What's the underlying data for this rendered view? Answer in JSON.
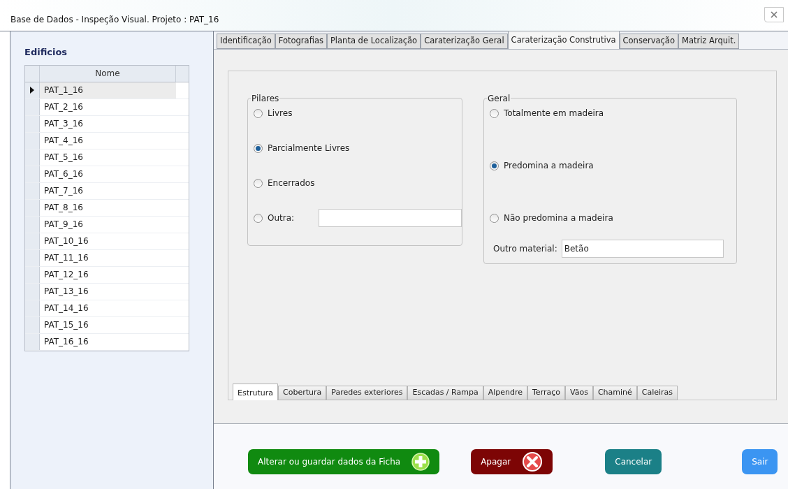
{
  "window": {
    "title": "Base de Dados - Inspeção Visual. Projeto : PAT_16"
  },
  "sidebar": {
    "title": "Edificios",
    "column": "Nome",
    "rows": [
      {
        "name": "PAT_1_16",
        "selected": true
      },
      {
        "name": "PAT_2_16",
        "selected": false
      },
      {
        "name": "PAT_3_16",
        "selected": false
      },
      {
        "name": "PAT_4_16",
        "selected": false
      },
      {
        "name": "PAT_5_16",
        "selected": false
      },
      {
        "name": "PAT_6_16",
        "selected": false
      },
      {
        "name": "PAT_7_16",
        "selected": false
      },
      {
        "name": "PAT_8_16",
        "selected": false
      },
      {
        "name": "PAT_9_16",
        "selected": false
      },
      {
        "name": "PAT_10_16",
        "selected": false
      },
      {
        "name": "PAT_11_16",
        "selected": false
      },
      {
        "name": "PAT_12_16",
        "selected": false
      },
      {
        "name": "PAT_13_16",
        "selected": false
      },
      {
        "name": "PAT_14_16",
        "selected": false
      },
      {
        "name": "PAT_15_16",
        "selected": false
      },
      {
        "name": "PAT_16_16",
        "selected": false
      }
    ]
  },
  "tabs": [
    {
      "label": "Identificação",
      "selected": false
    },
    {
      "label": "Fotografias",
      "selected": false
    },
    {
      "label": "Planta de Localização",
      "selected": false
    },
    {
      "label": "Caraterização Geral",
      "selected": false
    },
    {
      "label": "Caraterização Construtiva",
      "selected": true
    },
    {
      "label": "Conservação",
      "selected": false
    },
    {
      "label": "Matriz Arquit.",
      "selected": false
    }
  ],
  "groups": [
    {
      "legend": "Pilares",
      "options": [
        {
          "kind": "radio",
          "label": "Livres",
          "selected": false
        },
        {
          "kind": "radio",
          "label": "Parcialmente Livres",
          "selected": true
        },
        {
          "kind": "radio",
          "label": "Encerrados",
          "selected": false
        },
        {
          "kind": "radio_field",
          "label": "Outra:",
          "selected": false
        }
      ]
    },
    {
      "legend": "Geral",
      "options": [
        {
          "kind": "radio",
          "label": "Totalmente em madeira",
          "selected": false
        },
        {
          "kind": "radio",
          "label": "Predomina a madeira",
          "selected": true
        },
        {
          "kind": "radio",
          "label": "Não predomina a madeira",
          "selected": false
        }
      ],
      "field": {
        "label": "Outro material:",
        "value": "Betão"
      }
    }
  ],
  "subtabs": [
    {
      "label": "Estrutura",
      "selected": true
    },
    {
      "label": "Cobertura",
      "selected": false
    },
    {
      "label": "Paredes exteriores",
      "selected": false
    },
    {
      "label": "Escadas / Rampa",
      "selected": false
    },
    {
      "label": "Alpendre",
      "selected": false
    },
    {
      "label": "Terraço",
      "selected": false
    },
    {
      "label": "Vãos",
      "selected": false
    },
    {
      "label": "Chaminé",
      "selected": false
    },
    {
      "label": "Caleiras",
      "selected": false
    }
  ],
  "buttons": [
    {
      "kind": "plus",
      "label": "Alterar ou guardar dados da Ficha",
      "color": "#108a10"
    },
    {
      "kind": "cross",
      "label": "Apagar",
      "color": "#7d0505"
    },
    {
      "kind": "plain",
      "label": "Cancelar",
      "color": "#1b8087"
    },
    {
      "kind": "plain",
      "label": "Sair",
      "color": "#3b95f2"
    }
  ]
}
